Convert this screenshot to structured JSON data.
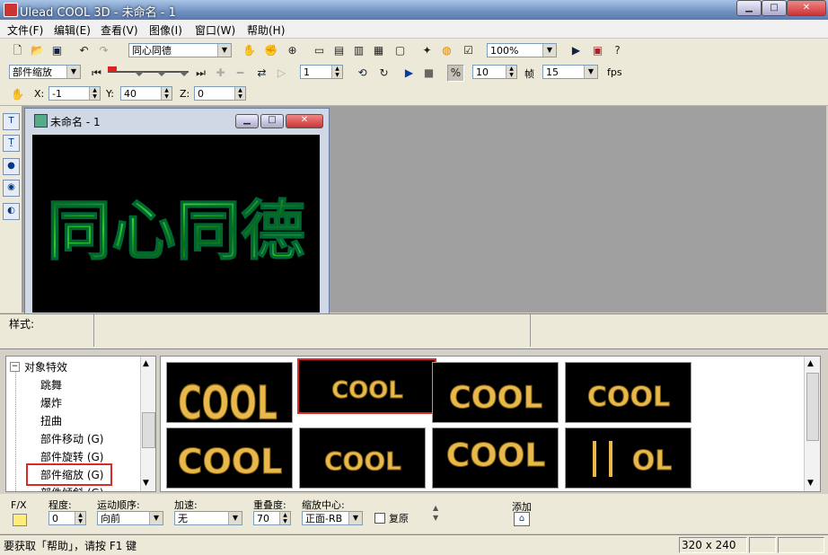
{
  "app": {
    "title": "Ulead COOL 3D - 未命名 - 1"
  },
  "menu": {
    "items": [
      "文件(F)",
      "编辑(E)",
      "查看(V)",
      "图像(I)",
      "窗口(W)",
      "帮助(H)"
    ]
  },
  "toolbar1": {
    "text_combo": "同心同德",
    "zoom_combo": "100%"
  },
  "toolbar2": {
    "effect_combo": "部件缩放",
    "frame_value": "1",
    "frames_count": "10",
    "frames_label": "帧",
    "fps_value": "15",
    "fps_label": "fps"
  },
  "toolbar3": {
    "x_label": "X:",
    "x_value": "-1",
    "y_label": "Y:",
    "y_value": "40",
    "z_label": "Z:",
    "z_value": "0"
  },
  "document": {
    "title": "未命名 - 1",
    "text": "同心同德"
  },
  "stylebar": {
    "label": "样式:"
  },
  "tree": {
    "root": "对象特效",
    "items": [
      "跳舞",
      "爆炸",
      "扭曲",
      "部件移动 (G)",
      "部件旋转 (G)",
      "部件缩放 (G)",
      "部件倾斜 (G)"
    ],
    "selected_index": 5
  },
  "thumbnails": [
    {
      "text": "COOL",
      "variant": "tall"
    },
    {
      "text": "COOL",
      "variant": "rings"
    },
    {
      "text": "COOL",
      "variant": "bigO"
    },
    {
      "text": "COOL",
      "variant": "bigC"
    },
    {
      "text": "COOL",
      "variant": "bold"
    },
    {
      "text": "COOL",
      "variant": "smallC"
    },
    {
      "text": "COOL",
      "variant": "mixed"
    },
    {
      "text": "OL",
      "variant": "bars"
    }
  ],
  "params": {
    "fx_label": "F/X",
    "degree_label": "程度:",
    "degree_value": "0",
    "order_label": "运动顺序:",
    "order_value": "向前",
    "accel_label": "加速:",
    "accel_value": "无",
    "overlap_label": "重叠度:",
    "overlap_value": "70",
    "center_label": "缩放中心:",
    "center_value": "正面-RB",
    "restore_label": "复原",
    "add_label": "添加"
  },
  "status": {
    "help_text": "要获取「帮助」，请按 F1 键",
    "dimensions": "320 x 240"
  },
  "colors": {
    "title_gradient": "#6f8fbf",
    "gold": "#e8b84a",
    "green": "#1fa01f",
    "highlight": "#d92a2a"
  }
}
